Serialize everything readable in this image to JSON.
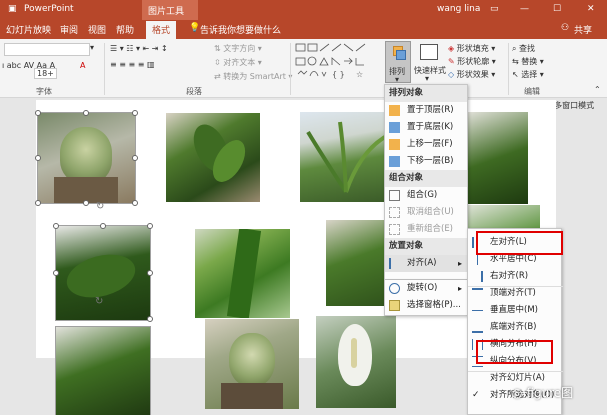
{
  "titlebar": {
    "app": "PowerPoint",
    "context": "图片工具",
    "user": "wang lina"
  },
  "tabs": [
    "幻灯片放映",
    "审阅",
    "视图",
    "帮助",
    "格式"
  ],
  "search_placeholder": "告诉我你想要做什么",
  "share": "共享",
  "ribbon": {
    "font_size": "18+",
    "text_direction": "文字方向",
    "align_text": "对齐文本",
    "convert_smartart": "转换为 SmartArt",
    "arrange": "排列",
    "quick_styles": "快速样式",
    "shape_fill": "形状填充",
    "shape_outline": "形状轮廓",
    "shape_effects": "形状效果",
    "find": "查找",
    "replace": "替换",
    "select": "选择",
    "group_font": "字体",
    "group_paragraph": "段落",
    "group_edit": "编辑",
    "multiwindow": "多窗口模式"
  },
  "arrange_menu": {
    "section_order": "排列对象",
    "bring_front": "置于顶层(R)",
    "send_back": "置于底层(K)",
    "bring_forward": "上移一层(F)",
    "send_backward": "下移一层(B)",
    "section_group": "组合对象",
    "group": "组合(G)",
    "ungroup": "取消组合(U)",
    "regroup": "重新组合(E)",
    "section_position": "放置对象",
    "align": "对齐(A)",
    "rotate": "旋转(O)",
    "selection_pane": "选择窗格(P)..."
  },
  "align_menu": {
    "left": "左对齐(L)",
    "center": "水平居中(C)",
    "right": "右对齐(R)",
    "top": "顶端对齐(T)",
    "middle": "垂直居中(M)",
    "bottom": "底端对齐(B)",
    "dist_h": "横向分布(H)",
    "dist_v": "纵向分布(V)",
    "to_slide": "对齐幻灯片(A)",
    "to_selected": "对齐所选对象(O)"
  },
  "watermark": "figure图",
  "colors": {
    "accent": "#b7472a",
    "highlight": "#e00000"
  }
}
